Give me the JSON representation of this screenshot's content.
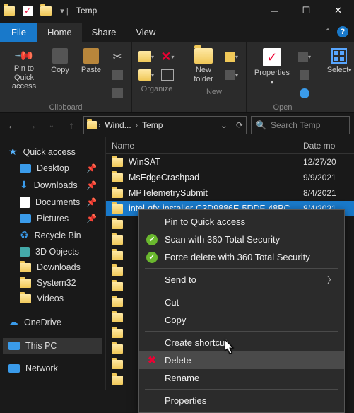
{
  "window": {
    "title": "Temp"
  },
  "tabs": {
    "file": "File",
    "home": "Home",
    "share": "Share",
    "view": "View"
  },
  "ribbon": {
    "pin": "Pin to Quick\naccess",
    "copy": "Copy",
    "paste": "Paste",
    "clipboard_label": "Clipboard",
    "organize_label": "Organize",
    "new_folder": "New\nfolder",
    "new_label": "New",
    "properties": "Properties",
    "open_label": "Open",
    "select": "Select"
  },
  "address": {
    "crumb1": "Wind...",
    "crumb2": "Temp",
    "search_placeholder": "Search Temp"
  },
  "sidebar": {
    "quick": "Quick access",
    "desktop": "Desktop",
    "downloads": "Downloads",
    "documents": "Documents",
    "pictures": "Pictures",
    "recycle": "Recycle Bin",
    "objects3d": "3D Objects",
    "downloads2": "Downloads",
    "system32": "System32",
    "videos": "Videos",
    "onedrive": "OneDrive",
    "thispc": "This PC",
    "network": "Network"
  },
  "columns": {
    "name": "Name",
    "date": "Date mo"
  },
  "files": [
    {
      "name": "WinSAT",
      "date": "12/27/20"
    },
    {
      "name": "MsEdgeCrashpad",
      "date": "9/9/2021"
    },
    {
      "name": "MPTelemetrySubmit",
      "date": "8/4/2021"
    },
    {
      "name": "intel-gfx-installer-C3D9886E-5DDF-48BC...",
      "date": "8/4/2021",
      "selected": true
    }
  ],
  "extra_rows": 11,
  "context_menu": {
    "pin": "Pin to Quick access",
    "scan_360": "Scan with 360 Total Security",
    "force_delete_360": "Force delete with 360 Total Security",
    "send_to": "Send to",
    "cut": "Cut",
    "copy": "Copy",
    "create_shortcut": "Create shortcut",
    "delete": "Delete",
    "rename": "Rename",
    "properties": "Properties"
  }
}
